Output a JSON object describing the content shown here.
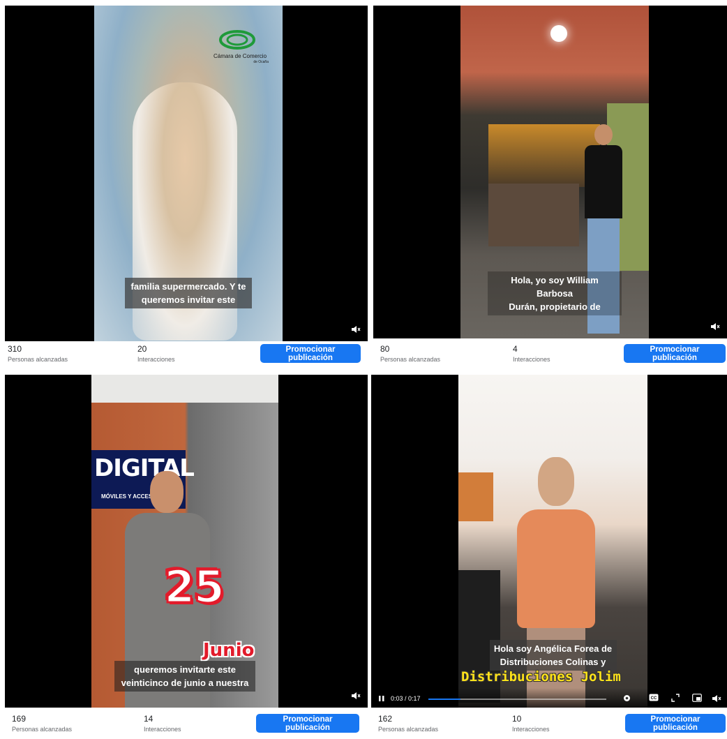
{
  "posts": [
    {
      "caption": "familia supermercado. Y te\nqueremos invitar este",
      "logo": "Cámara de Comercio",
      "logo_sub": "de Ocaña",
      "reach": "310",
      "reach_label": "Personas alcanzadas",
      "interactions": "20",
      "interactions_label": "Interacciones",
      "button": "Promocionar publicación"
    },
    {
      "caption": "Hola, yo soy William Barbosa\nDurán, propietario de",
      "reach": "80",
      "reach_label": "Personas alcanzadas",
      "interactions": "4",
      "interactions_label": "Interacciones",
      "button": "Promocionar publicación"
    },
    {
      "caption": "queremos invitarte este\nveinticinco de junio a nuestra",
      "sign": "DIGITAL",
      "sign_sub": "MÓVILES Y ACCESOR",
      "big_number": "25",
      "month": "Junio",
      "reach": "169",
      "reach_label": "Personas alcanzadas",
      "interactions": "14",
      "interactions_label": "Interacciones",
      "button": "Promocionar publicación"
    },
    {
      "caption": "Hola soy Angélica Forea de\nDistribuciones Colinas y",
      "title_overlay": "Distribuciones Jolim",
      "time": "0:03 / 0:17",
      "progress": 0.18,
      "reach": "162",
      "reach_label": "Personas alcanzadas",
      "interactions": "10",
      "interactions_label": "Interacciones",
      "button": "Promocionar publicación"
    }
  ],
  "icons": {
    "mute": "speaker-muted-icon",
    "pause": "pause-icon",
    "settings": "gear-icon",
    "cc": "closed-captions-icon",
    "fullscreen": "fullscreen-icon",
    "pip": "picture-in-picture-icon"
  },
  "colors": {
    "button": "#1877f2",
    "progress": "#1877f2",
    "red": "#e21b2b",
    "yellow": "#ffe21a"
  }
}
